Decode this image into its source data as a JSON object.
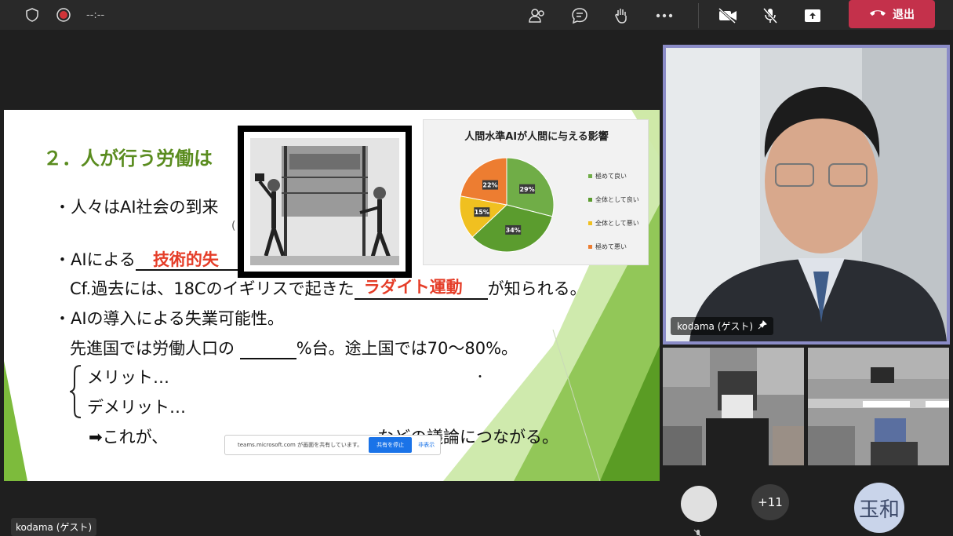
{
  "topbar": {
    "timer": "--:--",
    "leave_label": "退出"
  },
  "slide": {
    "title": "２．人が行う労働は",
    "line1": "・人々はAI社会の到来",
    "line1_paren": "(",
    "line2_prefix": "・AIによる",
    "line2_red": "技術的失",
    "line3_prefix": "Cf.過去には、18Cのイギリスで起きた",
    "line3_red": "ラダイト運動",
    "line3_suffix": "が知られる。",
    "line4": "・AIの導入による失業可能性。",
    "line5_prefix": "先進国では労働人口の",
    "line5_suffix": "%台。途上国では70～80%。",
    "merit": "メリット…",
    "demerit": "デメリット…",
    "line8_prefix": "➡これが、",
    "line8_suffix": "などの議論につながる。",
    "dot": "・"
  },
  "chart_data": {
    "type": "pie",
    "title": "人間水準AIが人間に与える影響",
    "categories": [
      "極めて良い",
      "全体として良い",
      "全体として悪い",
      "極めて悪い"
    ],
    "values": [
      29,
      34,
      15,
      22
    ],
    "value_labels": [
      "29%",
      "34%",
      "15%",
      "22%"
    ],
    "colors": [
      "#70ad47",
      "#5b9c2e",
      "#f0c020",
      "#ed7d31"
    ],
    "legend_position": "right"
  },
  "share_bar": {
    "text": "teams.microsoft.com が画面を共有しています。",
    "stop_label": "共有を停止",
    "hide_label": "非表示"
  },
  "participants": {
    "main_name": "kodama (ゲスト)",
    "more_count": "+11",
    "avatar_initials": "玉和",
    "bottom_name": "kodama (ゲスト)"
  },
  "colors": {
    "leave": "#c4314b",
    "active_border": "#8b8cc7",
    "slide_title": "#5a8c1f",
    "slide_red": "#e53d28"
  }
}
